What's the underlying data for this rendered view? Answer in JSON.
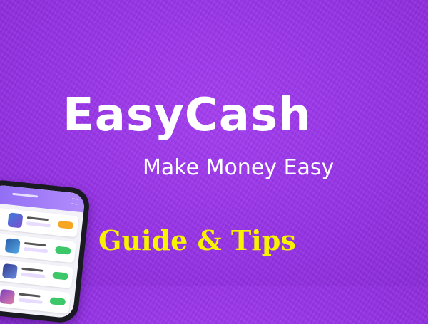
{
  "banner": {
    "title": "EasyCash",
    "tagline": "Make Money Easy",
    "subtitle": "Guide & Tips"
  },
  "colors": {
    "background": "#9633e6",
    "title": "#ffffff",
    "subtitle": "#f7f200"
  },
  "phone_mockup": {
    "icon": "smartphone-app-screenshot",
    "cards": 4
  }
}
